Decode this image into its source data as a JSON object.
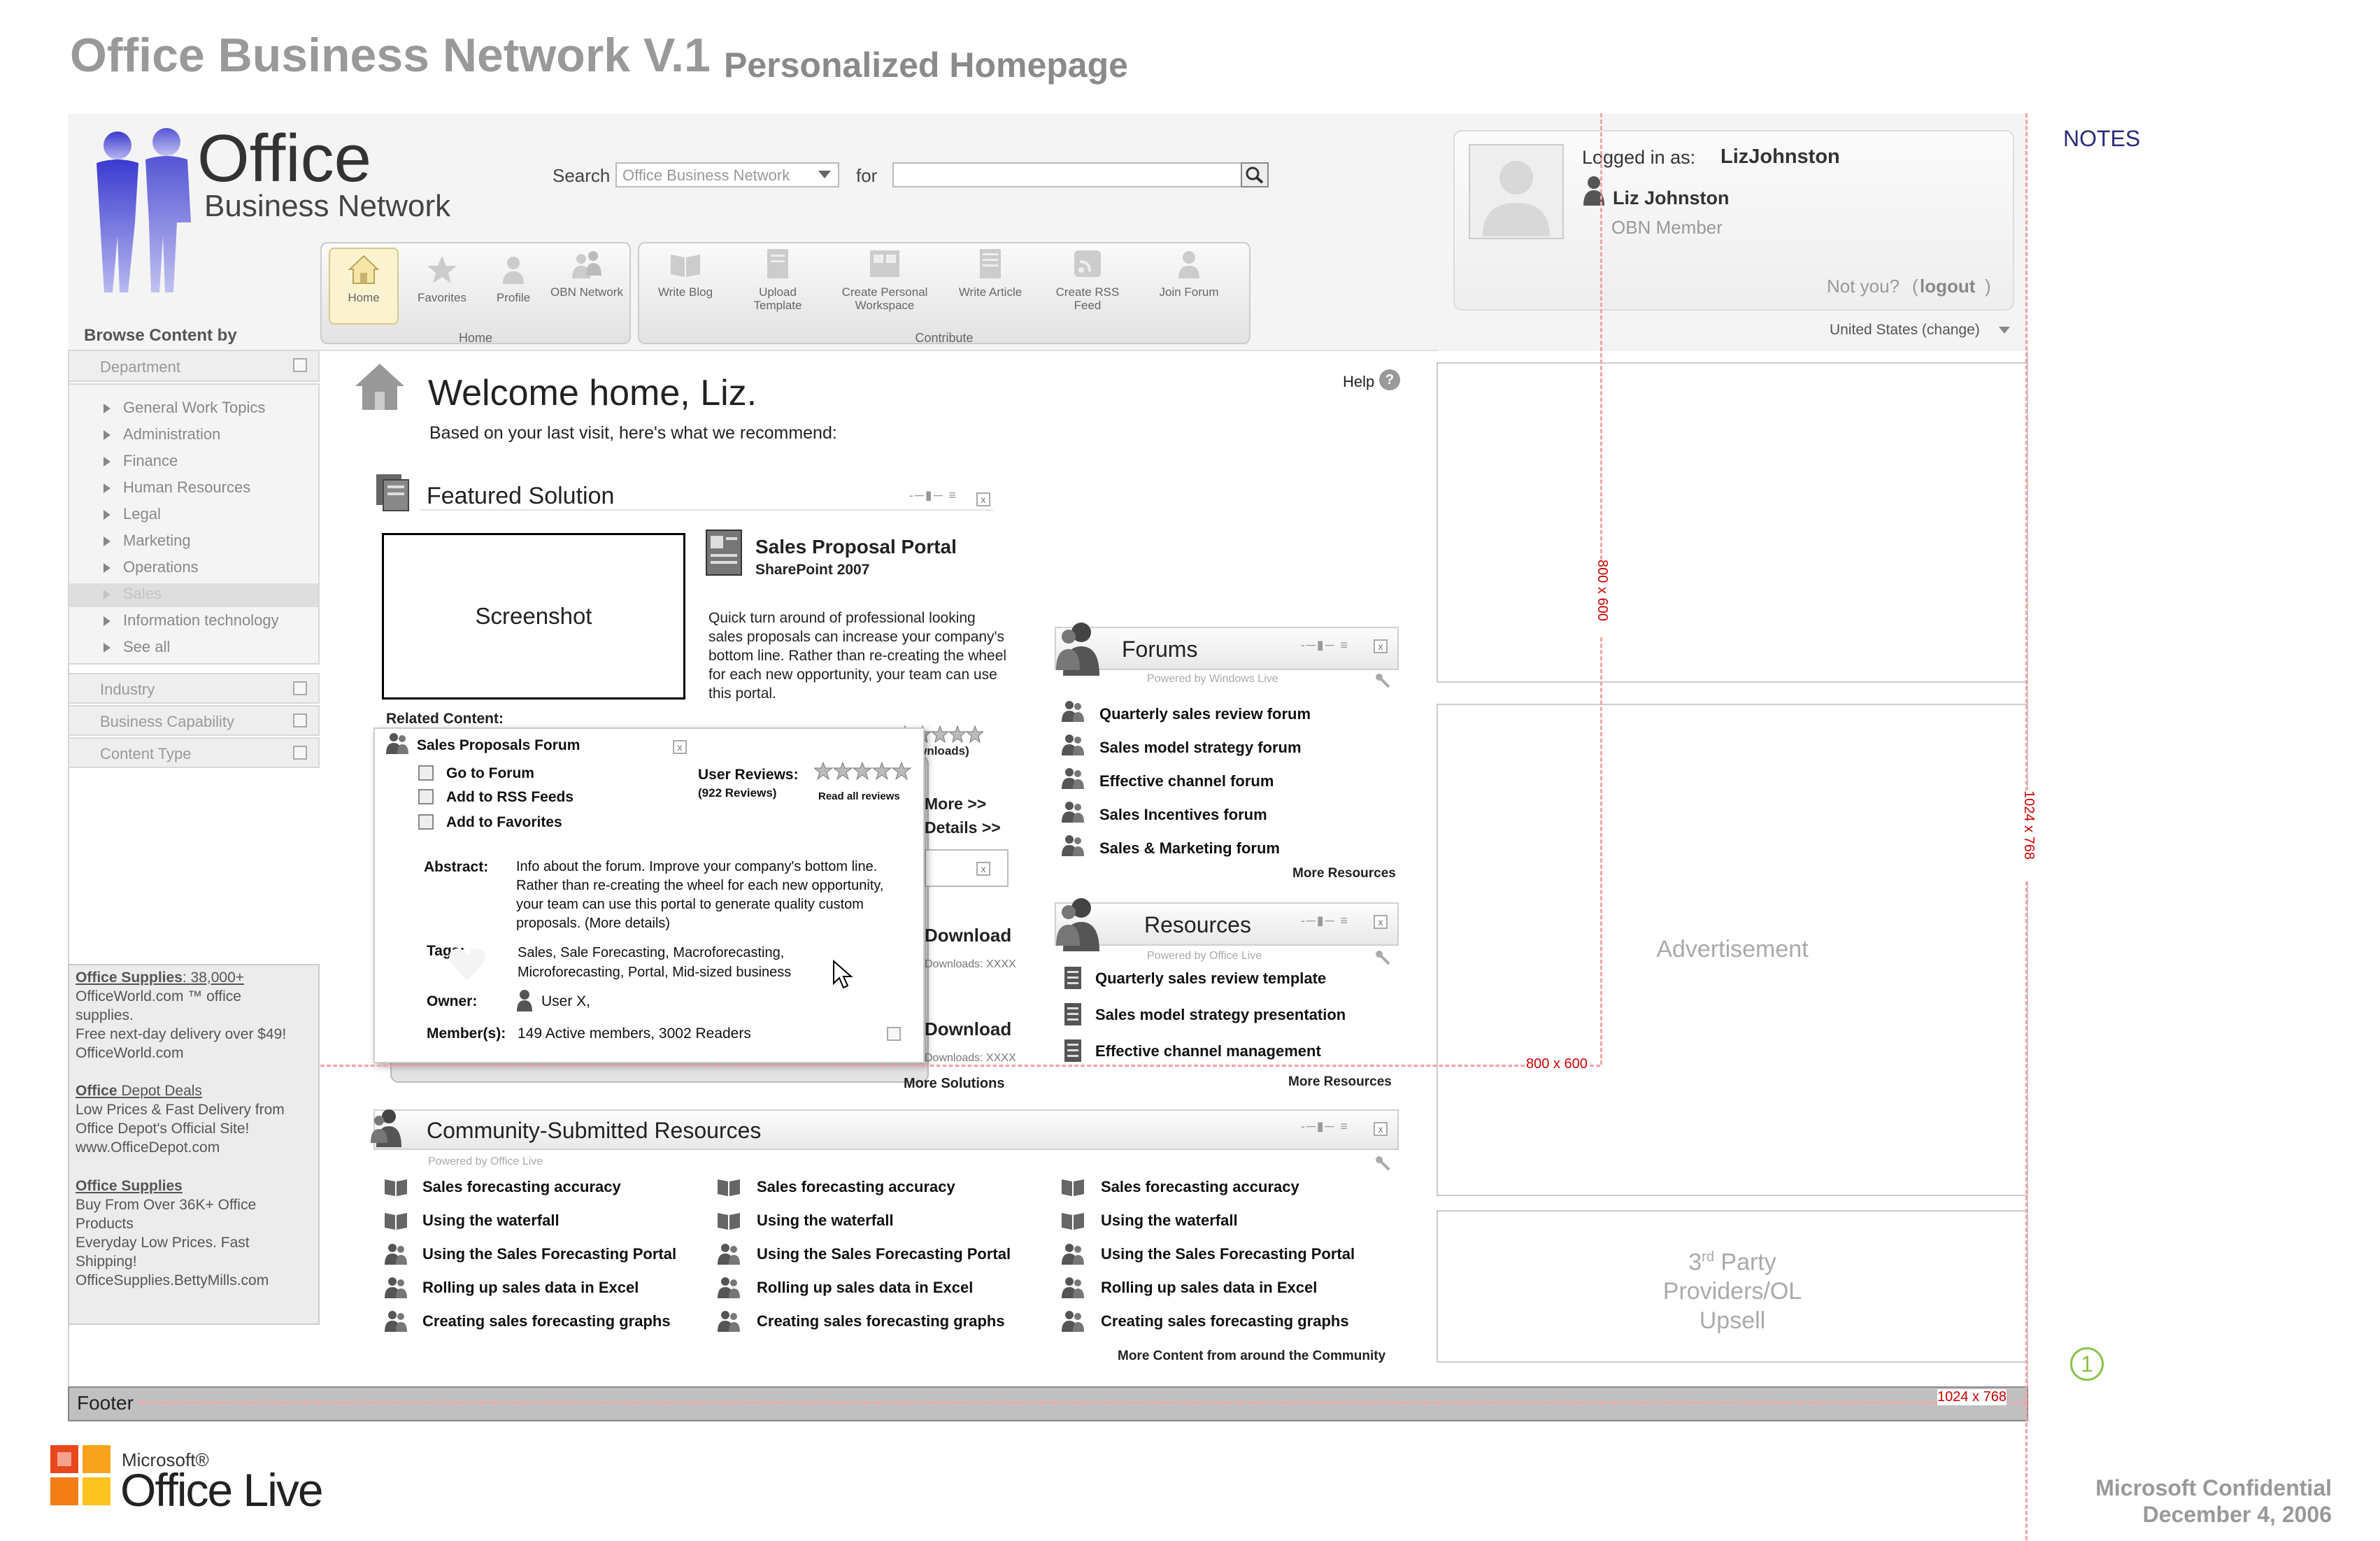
{
  "doc": {
    "title": "Office Business Network V.1",
    "subtitle": "Personalized Homepage"
  },
  "logo": {
    "office": "Office",
    "business_network": "Business Network"
  },
  "search": {
    "label": "Search",
    "scope": "Office Business Network",
    "for_label": "for"
  },
  "toolbar": {
    "home_group": {
      "label": "Home",
      "items": [
        "Home",
        "Favorites",
        "Profile",
        "OBN Network"
      ]
    },
    "contribute_group": {
      "label": "Contribute",
      "items": [
        "Write Blog",
        "Upload Template",
        "Create Personal Workspace",
        "Write Article",
        "Create RSS Feed",
        "Join Forum"
      ]
    }
  },
  "login": {
    "label": "Logged in as:",
    "username": "LizJohnston",
    "name": "Liz Johnston",
    "role": "OBN Member",
    "not_you": "Not you?",
    "logout": "logout",
    "locale": "United States (change)"
  },
  "sidebar": {
    "title": "Browse Content by",
    "department": "Department",
    "items": [
      "General Work Topics",
      "Administration",
      "Finance",
      "Human Resources",
      "Legal",
      "Marketing",
      "Operations",
      "Sales",
      "Information technology",
      "See all"
    ],
    "industry": "Industry",
    "business_capability": "Business Capability",
    "content_type": "Content Type"
  },
  "main": {
    "welcome": "Welcome home, Liz.",
    "welcome_sub": "Based on your last visit, here's what we recommend:",
    "help": "Help"
  },
  "featured": {
    "title": "Featured Solution",
    "screenshot": "Screenshot",
    "product_title": "Sales Proposal Portal",
    "product_sub": "SharePoint 2007",
    "description": "Quick turn around of professional looking sales proposals can  increase your company's bottom line. Rather than re-creating the wheel for each new opportunity, your team can use this portal.",
    "related": "Related Content:",
    "downloads_note": "(Based on 1023 Downloads)",
    "more": "More >>",
    "details": "Details >>",
    "download": "Download",
    "downloads_count": "Downloads: XXXX",
    "more_solutions": "More Solutions"
  },
  "popup": {
    "title": "Sales Proposals Forum",
    "actions": [
      "Go to Forum",
      "Add to RSS Feeds",
      "Add to Favorites"
    ],
    "reviews_label": "User Reviews:",
    "reviews_count": "(922 Reviews)",
    "read_all": "Read all reviews",
    "abstract_label": "Abstract:",
    "abstract": "Info about the forum.  Improve your company's bottom line. Rather than re-creating the wheel for each new opportunity, your team can use this portal to generate quality custom proposals. (More details)",
    "tags_label": "Tags:",
    "tags": "Sales, Sale Forecasting, Macroforecasting, Microforecasting, Portal, Mid-sized business",
    "owner_label": "Owner:",
    "owner": "User X,",
    "members_label": "Member(s):",
    "members": "149 Active members, 3002 Readers"
  },
  "forums": {
    "title": "Forums",
    "powered": "Powered by Windows Live",
    "items": [
      "Quarterly sales review forum",
      "Sales model strategy forum",
      "Effective channel forum",
      "Sales Incentives forum",
      "Sales & Marketing forum"
    ],
    "more": "More Resources"
  },
  "resources": {
    "title": "Resources",
    "powered": "Powered by Office Live",
    "items": [
      "Quarterly sales review template",
      "Sales model strategy presentation",
      "Effective channel management"
    ],
    "more": "More Resources"
  },
  "community": {
    "title": "Community-Submitted Resources",
    "powered": "Powered by Office Live",
    "items": [
      "Sales forecasting accuracy",
      "Using the waterfall",
      "Using the Sales Forecasting Portal",
      "Rolling up sales data in Excel",
      "Creating sales forecasting graphs"
    ],
    "more": "More Content from around the Community"
  },
  "ads": [
    {
      "head": "Office Supplies",
      "head_rest": ": 38,000+",
      "lines": [
        "OfficeWorld.com ™ office",
        "supplies.",
        "Free next-day delivery over $49!",
        "OfficeWorld.com"
      ]
    },
    {
      "head": "Office",
      "head_rest": " Depot Deals",
      "lines": [
        "Low Prices & Fast Delivery from",
        "Office Depot's Official Site!",
        "www.OfficeDepot.com"
      ]
    },
    {
      "head": "Office Supplies",
      "head_rest": "",
      "lines": [
        "Buy From Over 36K+ Office",
        "Products",
        "Everyday Low Prices. Fast",
        "Shipping!",
        "OfficeSupplies.BettyMills.com"
      ]
    }
  ],
  "right": {
    "advertisement": "Advertisement",
    "third_party_1": "3",
    "third_party_sup": "rd",
    "third_party_2": " Party",
    "third_party_3": "Providers/OL",
    "third_party_4": "Upsell"
  },
  "footer": "Footer",
  "dims": {
    "d800": "800 x 600",
    "d1024": "1024 x 768"
  },
  "notes": {
    "label": "NOTES",
    "marker": "1"
  },
  "confidential": {
    "line1": "Microsoft Confidential",
    "line2": "December 4, 2006"
  },
  "brand": {
    "microsoft": "Microsoft®",
    "office_live": "Office Live"
  }
}
